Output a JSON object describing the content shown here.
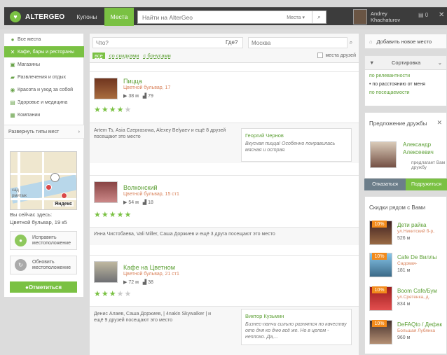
{
  "topbar": {
    "logo": "ALTERGEO",
    "tabs": [
      "Купоны",
      "Места"
    ],
    "search_placeholder": "Найти на AlterGeo",
    "search_scope": "Места",
    "user": {
      "first": "Andrey",
      "last": "Khachaturov"
    },
    "messages_count": "0"
  },
  "sidebar": {
    "categories": [
      "Все места",
      "Кафе, бары и рестораны",
      "Магазины",
      "Развлечения и отдых",
      "Красота и уход за собой",
      "Здоровье и медицина",
      "Компании"
    ],
    "expand_label": "Развернуть типы мест",
    "map_brand": "Яндекс",
    "here_label": "Вы сейчас здесь:",
    "here_address": "Цветной бульвар, 19 к5",
    "fix_location_label": "Исправить\nместоположение",
    "update_location_label": "Обновить\nместоположение",
    "checkin_label": "Отметиться"
  },
  "filters": {
    "what_placeholder": "Что?",
    "where_label": "Где?",
    "where_value": "Москва",
    "tags": [
      "все",
      "со скидками",
      "с бонусами"
    ],
    "friends_places": "места друзей"
  },
  "places": [
    {
      "title": "Пицца",
      "address": "Цветной бульвар, 17",
      "distance": "38 м",
      "checkins": "79",
      "rating": 4,
      "friends_text": "Artem Ts, Asia Czeprasowa, Alexey Belyaev и ещё 8 друзей посещают это место",
      "review_author": "Георгий Чернов",
      "review_text": "Вкусная пицца! Особенно понравилась мясная и острая."
    },
    {
      "title": "Волконский",
      "address": "Цветной бульвар, 15 ст1",
      "distance": "54 м",
      "checkins": "18",
      "rating": 5,
      "friends_text": "Инна Чистобаева, Vali Miller, Саша Доржиев и ещё 3 друга посещают это место"
    },
    {
      "title": "Кафе на Цветном",
      "address": "Цветной бульвар, 21 ст1",
      "distance": "72 м",
      "checkins": "38",
      "rating": 3,
      "friends_text": "Денис Алаев, Саша Доржиев, | 4nakin Skywalker | и ещё 9 друзей посещают это место",
      "review_author": "Виктор Кузьмин",
      "review_text": "Бизнес-ланчи сильно разнятся по качеству ото дня ко дню всё же. Но в целом - неплохо. Да,..."
    }
  ],
  "right": {
    "add_place": "Добавить новое место",
    "sort_title": "Сортировка",
    "sort_options": [
      "по релевантности",
      "по расстоянию от меня",
      "по посещаемости"
    ],
    "friend_suggestion": {
      "title": "Предложение дружбы",
      "name": "Александр Алексеевич",
      "desc": "предлагает Вам дружбу",
      "reject": "Отказаться",
      "accept": "Подружиться"
    },
    "discounts_title": "Скидки рядом с Вами",
    "deals": [
      {
        "badge": "10%",
        "name": "Дети райка",
        "address": "ул.Никитский б-р,",
        "distance": "526 м"
      },
      {
        "badge": "10%",
        "name": "Cafe De Виллы",
        "address": "Садовая-",
        "distance": "181 м"
      },
      {
        "badge": "10%",
        "name": "Boom Cafe/Бум",
        "address": "ул.Сретенка, д.",
        "distance": "834 м"
      },
      {
        "badge": "10%",
        "name": "DeFAQto / Дефак",
        "address": "Большая Лубянка",
        "distance": "960 м"
      }
    ]
  },
  "colors": {
    "accent": "#7ac143",
    "link": "#5c9f34",
    "address": "#d9825b",
    "dark": "#3c3c3c",
    "badge": "#f28a1b"
  },
  "icons": {
    "logo": "altergeo-logo-icon",
    "search": "search-icon",
    "user": "avatar",
    "messages": "messages-icon",
    "close": "close-icon",
    "location": "location-pin-icon",
    "checkins": "checkins-icon",
    "sort": "filter-icon",
    "add_place": "add-place-icon"
  }
}
